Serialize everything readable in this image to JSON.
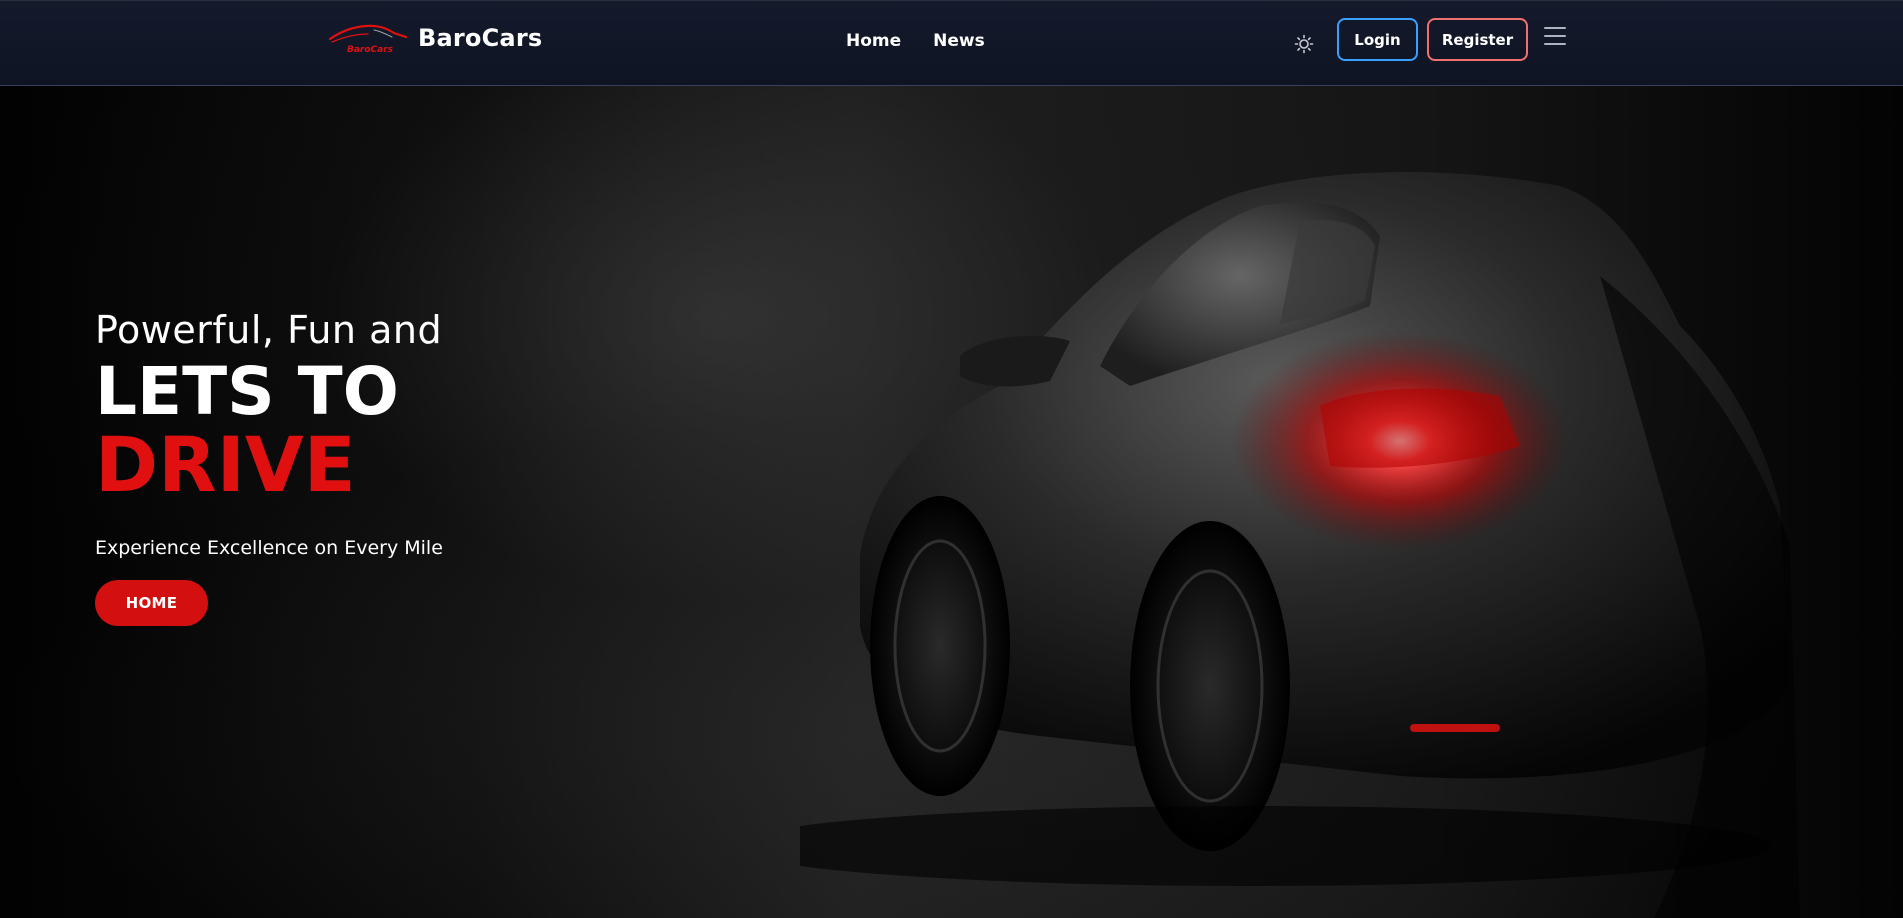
{
  "navbar": {
    "brand_logo_text": "BaroCars",
    "brand_name": "BaroCars",
    "links": [
      {
        "label": "Home"
      },
      {
        "label": "News"
      }
    ],
    "theme_icon": "sun-icon",
    "login_label": "Login",
    "register_label": "Register",
    "menu_icon": "hamburger-menu-icon"
  },
  "hero": {
    "subtitle": "Powerful, Fun and",
    "title_line1": "LETS TO",
    "title_line2": "DRIVE",
    "tagline": "Experience Excellence on Every Mile",
    "button_label": "HOME",
    "image": "black-sports-car-rear-view"
  },
  "colors": {
    "nav_bg": "#141a2b",
    "accent_red": "#e01010",
    "button_red": "#d40f0f",
    "login_border": "#3aa0ff",
    "register_border": "#f07070"
  }
}
